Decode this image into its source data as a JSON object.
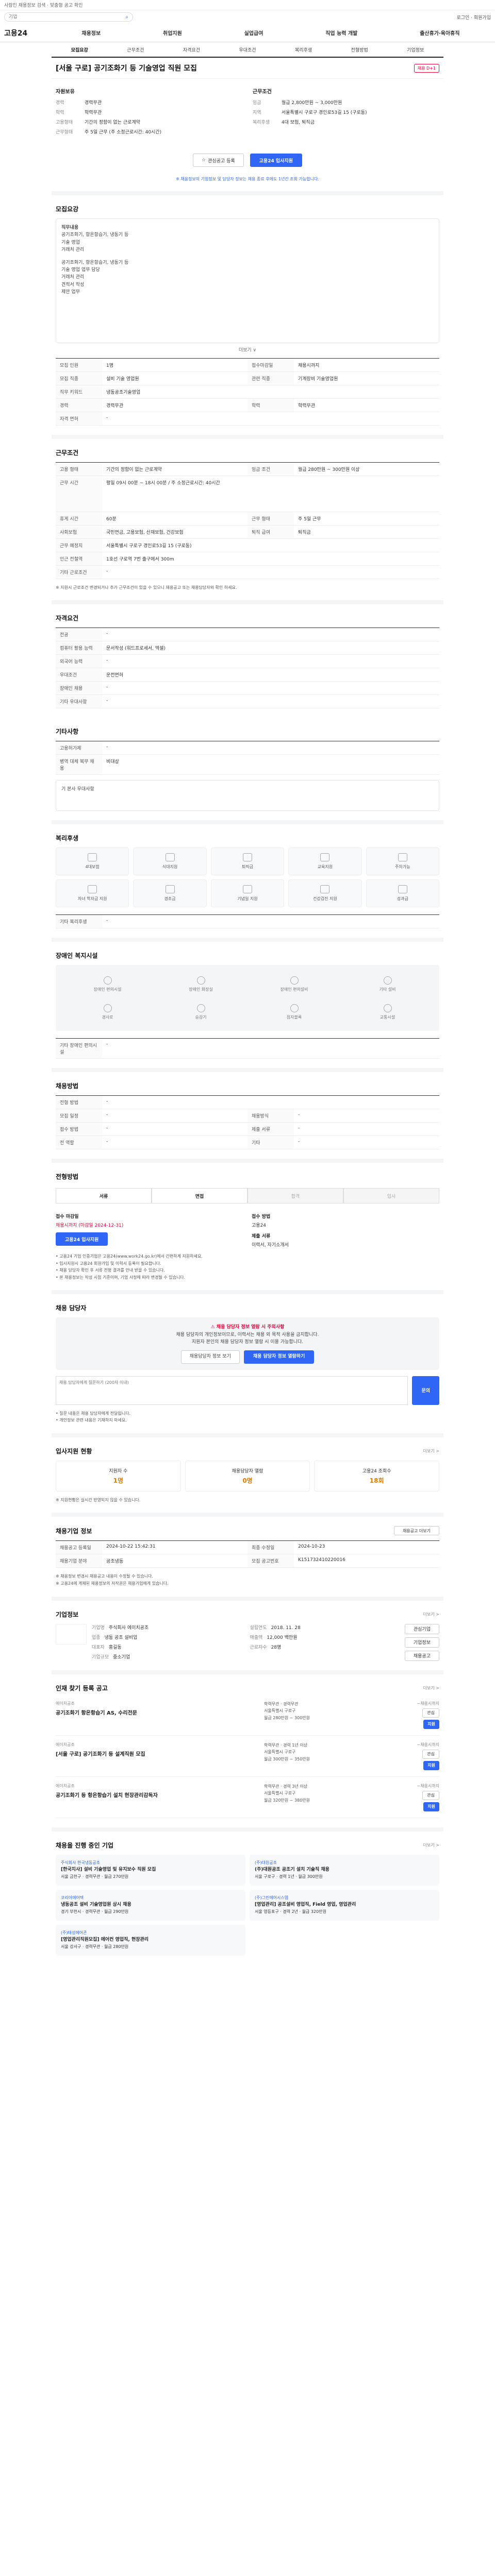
{
  "topbar": {
    "text": "사람인 채용정보 검색 · 맞춤형 공고 확인"
  },
  "search": {
    "placeholder": "기업"
  },
  "header": {
    "right": "로그인 · 회원가입"
  },
  "gnb": {
    "logo": "고용24",
    "menus": [
      "채용정보",
      "취업지원",
      "실업급여",
      "직업 능력 개발",
      "출산휴가·육아휴직"
    ]
  },
  "tabs": [
    "모집요강",
    "근무조건",
    "자격요건",
    "우대조건",
    "복리후생",
    "전형방법",
    "기업정보"
  ],
  "job": {
    "title": "[서울 구로] 공기조화기 등 기술영업 직원 모집",
    "badge": "채용 D+1",
    "left_title": "자원보유",
    "left_kv": [
      {
        "k": "경력",
        "v": "경력무관"
      },
      {
        "k": "학력",
        "v": "학력무관"
      },
      {
        "k": "고용형태",
        "v": "기간의 정함이 없는 근로계약"
      },
      {
        "k": "근무형태",
        "v": "주 5일 근무 (주 소정근로시간: 40시간)"
      }
    ],
    "right_title": "근무조건",
    "right_kv": [
      {
        "k": "임금",
        "v": "월급 2,800만원 ~ 3,000만원"
      },
      {
        "k": "지역",
        "v": "서울특별시 구로구 경인로53길 15 (구로동)"
      },
      {
        "k": "복리후생",
        "v": "4대 보험, 퇴직금"
      }
    ],
    "scrap_label": "관심공고 등록",
    "apply_label": "고용24 입사지원",
    "notice": "※ 채용정보의 기업정보 및 담당자 정보는 채용 종료 후에도 1년간 조회 가능합니다."
  },
  "recruit": {
    "title": "모집요강",
    "box_lines": [
      "직무내용",
      "공기조화기, 항온항습기, 냉동기 등",
      "기술 영업",
      "거래처 관리",
      "",
      "공기조화기, 항온항습기, 냉동기 등",
      "기술 영업 업무 담당",
      "거래처 관리",
      "견적서 작성",
      "제안 업무"
    ],
    "more": "더보기 ∨",
    "rows": [
      {
        "th": "모집 인원",
        "td": "1명",
        "th2": "접수마감일",
        "td2": "채용시까지"
      },
      {
        "th": "모집 직종",
        "td": "설비 기술 영업원",
        "th2": "관련 직종",
        "td2": "기계장비 기술영업원"
      },
      {
        "th": "직무 키워드",
        "td": "냉동공조기술영업"
      },
      {
        "th": "경력",
        "td": "경력무관",
        "th2": "학력",
        "td2": "학력무관"
      },
      {
        "th": "자격 면허",
        "td": "-"
      }
    ]
  },
  "conditions": {
    "title": "근무조건",
    "rows": [
      {
        "th": "고용 형태",
        "td": "기간의 정함이 없는 근로계약",
        "th2": "임금 조건",
        "td2": "월급 280만원 ~ 300만원 이상"
      },
      {
        "th": "근무 시간",
        "td": "평일 09시 00분 ~ 18시 00분 / 주 소정근로시간: 40시간"
      },
      {
        "th": "휴게 시간",
        "td": "60분",
        "th2": "근무 형태",
        "td2": "주 5일 근무"
      },
      {
        "th": "사회보험",
        "td": "국민연금, 고용보험, 산재보험, 건강보험",
        "th2": "퇴직 급여",
        "td2": "퇴직금"
      },
      {
        "th": "근무 예정지",
        "td": "서울특별시 구로구 경인로53길 15 (구로동)"
      },
      {
        "th": "인근 전철역",
        "td": "1호선 구로역 7번 출구에서 300m"
      },
      {
        "th": "기타 근로조건",
        "td": "-"
      }
    ],
    "notice": "※ 지원시 근로조건 변경되거나 추가 근무조건이 있을 수 있으니 채용공고 또는 채용담당자와 확인 하세요."
  },
  "qualification": {
    "title": "자격요건",
    "rows": [
      {
        "th": "전공",
        "td": "-"
      },
      {
        "th": "컴퓨터 활용 능력",
        "td": "문서작성 (워드프로세서, 엑셀)"
      },
      {
        "th": "외국어 능력",
        "td": "-"
      },
      {
        "th": "우대조건",
        "td": "운전면허"
      },
      {
        "th": "장애인 채용",
        "td": "-"
      },
      {
        "th": "기타 우대사항",
        "td": "-"
      }
    ]
  },
  "preference": {
    "title": "기타사항",
    "rows": [
      {
        "th": "고용허가제",
        "td": "-"
      },
      {
        "th": "병역 대체 복무 채용",
        "td": "비대상"
      }
    ],
    "more_title": "기 본사 우대사항"
  },
  "welfare": {
    "title": "복리후생",
    "items": [
      "4대보험",
      "식대지원",
      "퇴직금",
      "교육지원",
      "주차가능",
      "자녀 학자금 지원",
      "경조금",
      "기념일 지원",
      "건강검진 지원",
      "성과급"
    ],
    "extra_label": "기타 복리후생",
    "extra_value": "-"
  },
  "disability": {
    "title": "장애인 복지시설",
    "items": [
      "장애인 편의시설",
      "장애인 화장실",
      "장애인 편의설비",
      "기타 설비",
      "경사로",
      "승강기",
      "점자블록",
      "교통시설"
    ],
    "extra_label": "기타 장애인 편의시설",
    "extra_value": "-"
  },
  "screening": {
    "title": "채용방법",
    "rows": [
      {
        "th": "전형 방법",
        "td": "-"
      },
      {
        "th": "모집 일정",
        "td": "-",
        "th2": "채용방식",
        "td2": "-"
      },
      {
        "th": "접수 방법",
        "td": "-",
        "th2": "제출 서류",
        "td2": "-"
      },
      {
        "th": "전 역할",
        "td": "-",
        "th2": "기타",
        "td2": "-"
      }
    ]
  },
  "process": {
    "title": "전형방법",
    "steps": [
      "서류",
      "면접",
      "합격",
      "입사"
    ],
    "apply_label": "접수 마감일",
    "apply_value": "채용시까지 (마감일 2024-12-31)",
    "apply_button": "고용24 입사지원",
    "doc_label": "접수 방법",
    "doc_value": "고용24",
    "submit_label": "제출 서류",
    "submit_value": "이력서, 자기소개서",
    "bullets": [
      "• 고용24 기업 인증기업은 고용24(www.work24.go.kr)에서 간편하게 지원하세요.",
      "• 입사지원시 고용24 회원가입 및 이력서 등록이 필요합니다.",
      "• 채용 담당자 확인 후 서류 전형 결과를 안내 받을 수 있습니다.",
      "• 본 채용정보는 작성 시점 기준이며, 기업 사정에 따라 변경될 수 있습니다."
    ]
  },
  "contact": {
    "title": "채용 담당자",
    "warn_title": "채용 담당자 정보 열람 시 주의사항",
    "warn_lines": [
      "채용 담당자의 개인정보이므로, 이력서는 채용 외 목적 사용을 금지합니다.",
      "지원자 본인의 채용 담당자 정보 열람 시 이용 가능합니다."
    ],
    "btn1": "채용담당자 정보 보기",
    "btn2": "채용 담당자 정보 열람하기",
    "qa_placeholder": "채용 담당자에게 질문하기 (200자 이내)",
    "qa_button": "문의",
    "bullets": [
      "• 질문 내용은 채용 담당자에게 전달됩니다.",
      "• 개인정보 관련 내용은 기재하지 마세요."
    ]
  },
  "status": {
    "title": "입사지원 현황",
    "more": "더보기 >",
    "items": [
      {
        "label": "지원자 수",
        "num": "1명"
      },
      {
        "label": "채용담당자 열람",
        "num": "0명"
      },
      {
        "label": "고용24 조회수",
        "num": "18회"
      }
    ],
    "notice": "※ 지원현황은 실시간 반영되지 않을 수 있습니다."
  },
  "posting": {
    "title": "채용기업 정보",
    "more": "채용공고 더보기",
    "rows": [
      {
        "th": "채용공고 등록일",
        "td": "2024-10-22 15:42:31",
        "th2": "최종 수정일",
        "td2": "2024-10-23"
      },
      {
        "th": "채용기업 분야",
        "td": "공조냉동",
        "th2": "모집 공고번호",
        "td2": "K151732410220016"
      }
    ],
    "bullets": [
      "※ 채용정보 변경시 채용공고 내용이 수정될 수 있습니다.",
      "※ 고용24에 게재된 채용정보의 저작권은 채용기업에게 있습니다."
    ]
  },
  "company": {
    "title": "기업정보",
    "more": "더보기 >",
    "fields": [
      {
        "k": "기업명",
        "v": "주식회사 에이치공조"
      },
      {
        "k": "설립연도",
        "v": "2018. 11. 28"
      },
      {
        "k": "업종",
        "v": "냉동 공조 설비업"
      },
      {
        "k": "매출액",
        "v": "12,000 백만원"
      },
      {
        "k": "대표자",
        "v": "홍길동"
      },
      {
        "k": "근로자수",
        "v": "28명"
      },
      {
        "k": "기업규모",
        "v": "중소기업"
      }
    ],
    "btns": [
      "관심기업",
      "기업정보",
      "채용공고"
    ]
  },
  "related": {
    "title": "인재 찾기 등록 공고",
    "more": "더보기 >",
    "items": [
      {
        "co": "에이치공조",
        "title": "공기조화기 항온항습기 AS, 수리전문",
        "meta": [
          "학력무관 · 경력무관",
          "서울특별시 구로구",
          "월급 280만원 ~ 300만원"
        ],
        "date": "~채용시까지"
      },
      {
        "co": "에이치공조",
        "title": "[서울 구로] 공기조화기 등 설계직원 모집",
        "meta": [
          "학력무관 · 경력 1년 이상",
          "서울특별시 구로구",
          "월급 300만원 ~ 350만원"
        ],
        "date": "~채용시까지"
      },
      {
        "co": "에이치공조",
        "title": "공기조화기 등 항온항습기 설치 현장관리감독자",
        "meta": [
          "학력무관 · 경력 3년 이상",
          "서울특별시 구로구",
          "월급 320만원 ~ 380만원"
        ],
        "date": "~채용시까지"
      }
    ],
    "btn_save": "관심",
    "btn_apply": "지원"
  },
  "similar": {
    "title": "채용을 진행 중인 기업",
    "more": "더보기 >",
    "items": [
      {
        "co": "주식회사 한국냉동공조",
        "title": "[한국지사] 설비 기술영업 및 유지보수 직원 모집",
        "meta": "서울 금천구 · 경력무관 · 월급 270만원"
      },
      {
        "co": "(주)대원공조",
        "title": "(주)대원공조 공조기 설치 기술직 채용",
        "meta": "서울 구로구 · 경력 1년 · 월급 300만원"
      },
      {
        "co": "코리아에어텍",
        "title": "냉동공조 설비 기술영업원 상시 채용",
        "meta": "경기 부천시 · 경력무관 · 월급 290만원"
      },
      {
        "co": "(주)그린에어시스템",
        "title": "[영업관리] 공조설비 영업직, Field 영업, 영업관리",
        "meta": "서울 영등포구 · 경력 2년 · 월급 320만원"
      },
      {
        "co": "(주)태성에어콘",
        "title": "[영업관리직원모집] 에어컨 영업직, 현장관리",
        "meta": "서울 강서구 · 경력무관 · 월급 280만원"
      }
    ]
  }
}
